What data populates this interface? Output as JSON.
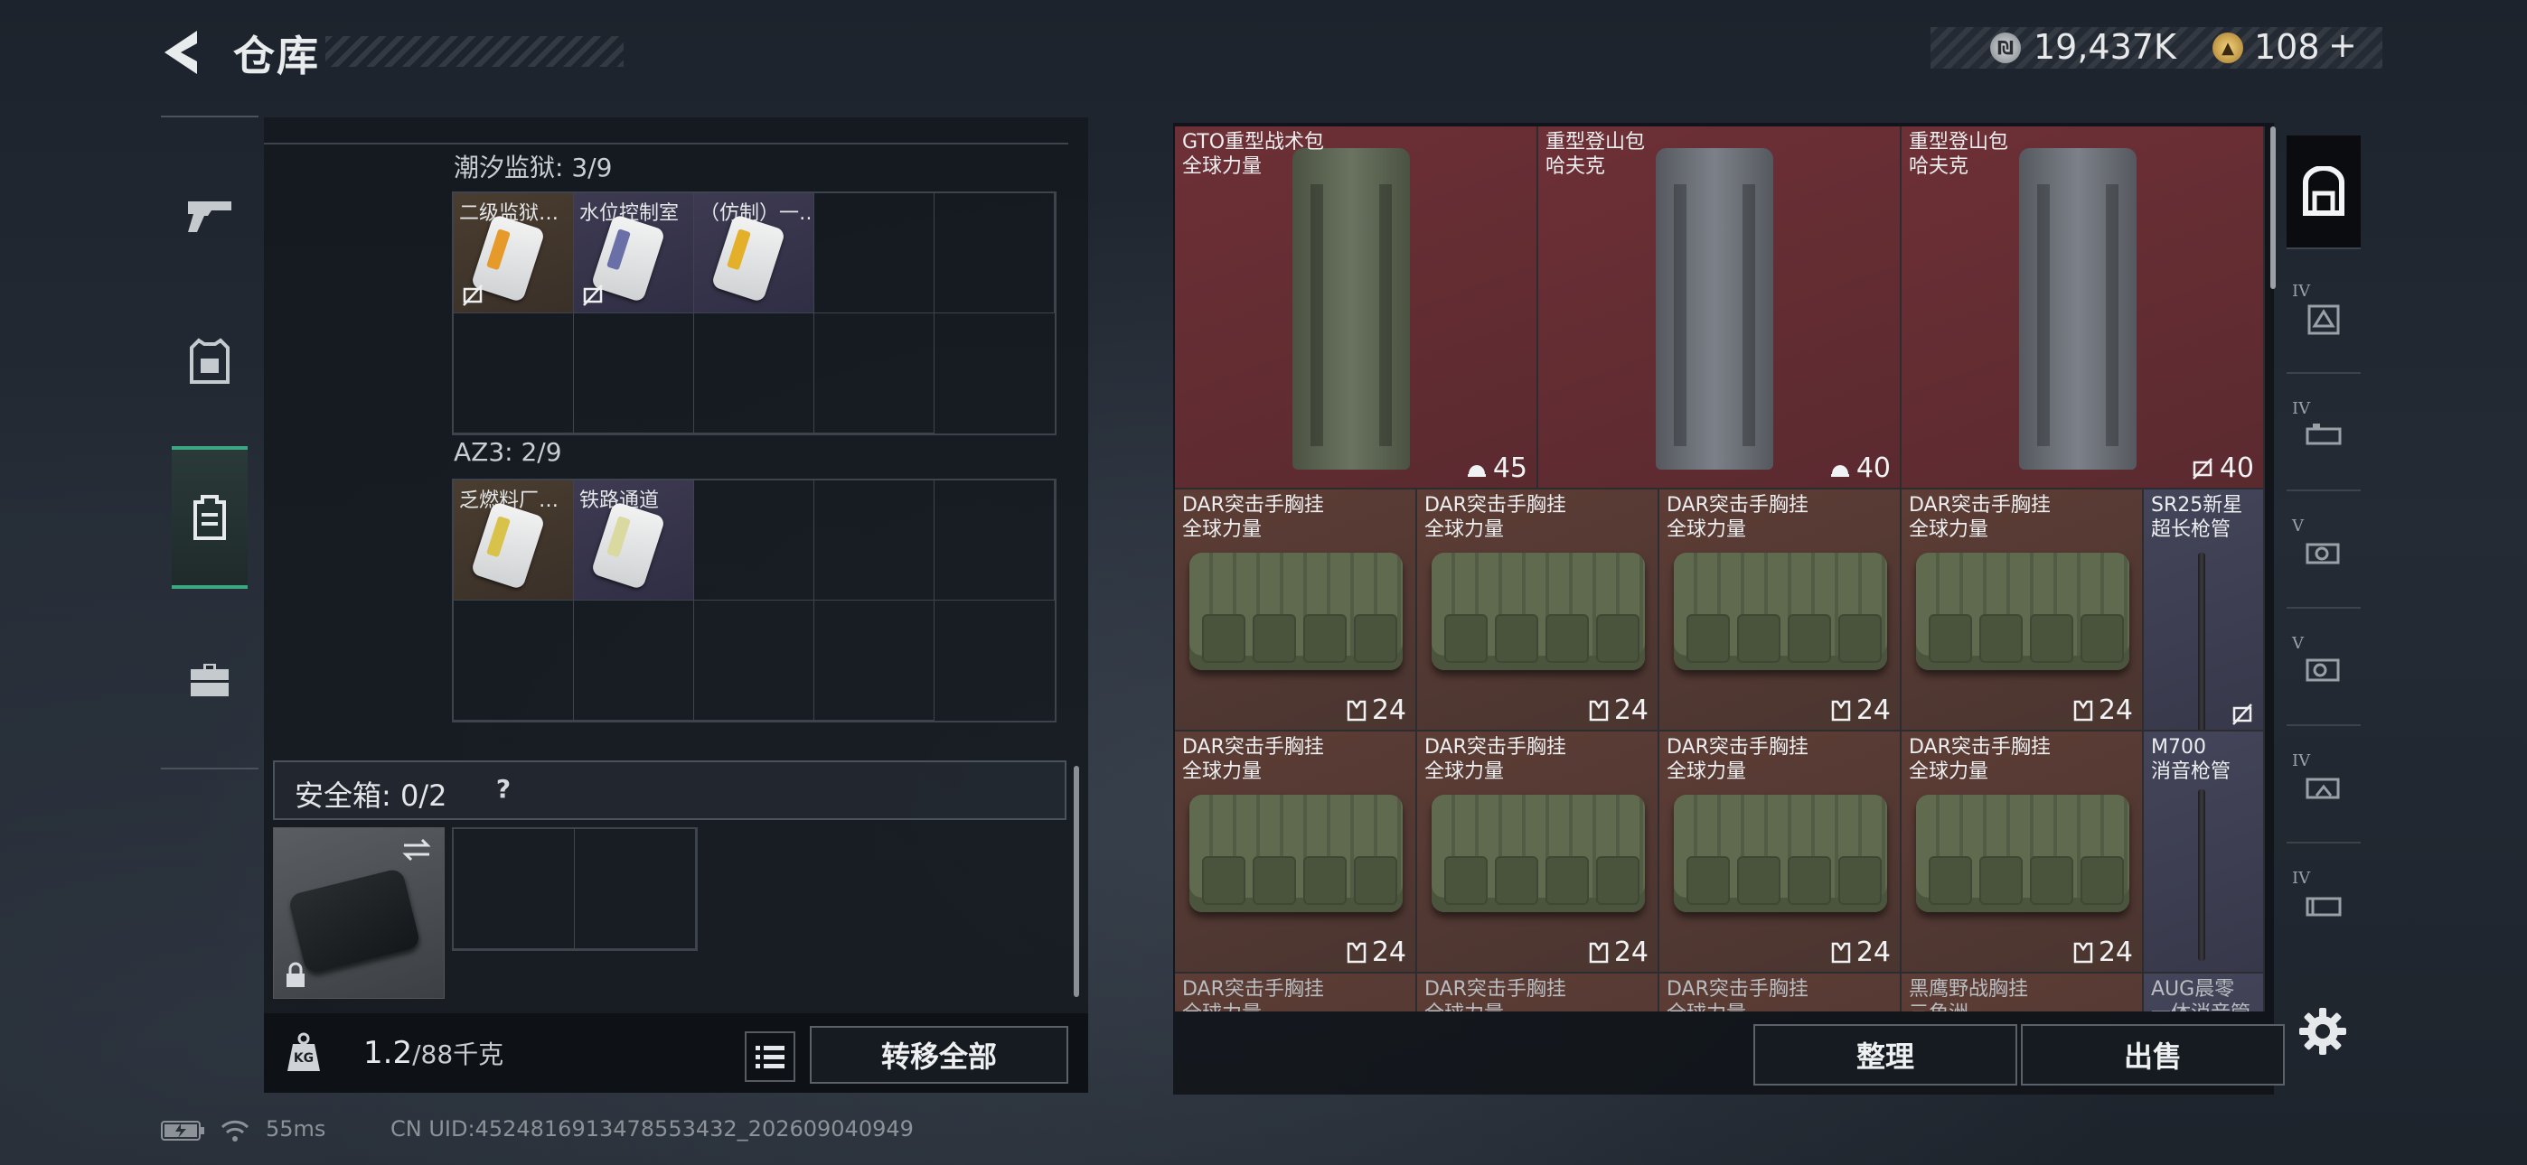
{
  "header": {
    "title": "仓库"
  },
  "currency": {
    "silver": "19,437K",
    "gold": "108",
    "plus": "+"
  },
  "left_nav": [
    {
      "icon": "pistol-icon"
    },
    {
      "icon": "armor-icon"
    },
    {
      "icon": "backpack-icon"
    },
    {
      "icon": "toolbox-icon"
    }
  ],
  "keycards": {
    "chaoxi": {
      "label": "潮汐监狱: 3/9",
      "cards": [
        {
          "name": "二级监狱…",
          "stripe": "#e59a2a"
        },
        {
          "name": "水位控制室（仿制）…",
          "stripe": "#6a6fa8"
        },
        {
          "name": "（仿制）一…",
          "stripe": "#e4b02a"
        }
      ]
    },
    "az3": {
      "label": "AZ3: 2/9",
      "cards": [
        {
          "name": "乏燃料厂…",
          "stripe": "#d8c24a"
        },
        {
          "name": "铁路通道",
          "stripe": "#d9d9a0"
        }
      ]
    }
  },
  "safebox": {
    "label": "安全箱: 0/2",
    "help": "?"
  },
  "weight": {
    "current": "1.2",
    "capacity": "/88千克",
    "icon_text": "KG"
  },
  "buttons": {
    "transfer_all": "转移全部",
    "sort": "整理",
    "sell": "出售"
  },
  "stash": {
    "backpacks": [
      {
        "name1": "GTO重型战术包",
        "name2": "全球力量",
        "count": "45",
        "count_icon": "helmet-icon",
        "color": "#5c6453"
      },
      {
        "name1": "重型登山包",
        "name2": "哈夫克",
        "count": "40",
        "count_icon": "helmet-icon",
        "color": "#6a6f7a"
      },
      {
        "name1": "重型登山包",
        "name2": "哈夫克",
        "count": "40",
        "count_icon": "no-insure-icon",
        "color": "#6a6f7a"
      }
    ],
    "rigs_row1": [
      {
        "name1": "DAR突击手胸挂",
        "name2": "全球力量",
        "count": "24"
      },
      {
        "name1": "DAR突击手胸挂",
        "name2": "全球力量",
        "count": "24"
      },
      {
        "name1": "DAR突击手胸挂",
        "name2": "全球力量",
        "count": "24"
      },
      {
        "name1": "DAR突击手胸挂",
        "name2": "全球力量",
        "count": "24"
      }
    ],
    "rigs_row2": [
      {
        "name1": "DAR突击手胸挂",
        "name2": "全球力量",
        "count": "24"
      },
      {
        "name1": "DAR突击手胸挂",
        "name2": "全球力量",
        "count": "24"
      },
      {
        "name1": "DAR突击手胸挂",
        "name2": "全球力量",
        "count": "24"
      },
      {
        "name1": "DAR突击手胸挂",
        "name2": "全球力量",
        "count": "24"
      }
    ],
    "rigs_row3": [
      {
        "name1": "DAR突击手胸挂",
        "name2": "全球力量"
      },
      {
        "name1": "DAR突击手胸挂",
        "name2": "全球力量"
      },
      {
        "name1": "DAR突击手胸挂",
        "name2": "全球力量"
      },
      {
        "name1": "黑鹰野战胸挂",
        "name2": "三角洲"
      }
    ],
    "side_items": [
      {
        "name1": "SR25新星",
        "name2": "超长枪管"
      },
      {
        "name1": "M700",
        "name2": "消音枪管"
      },
      {
        "name1": "AUG晨零",
        "name2": "一体消音管"
      }
    ]
  },
  "right_nav": [
    {
      "tier": "",
      "icon": "backpack-category-icon"
    },
    {
      "tier": "IV",
      "icon": "armor-category-icon"
    },
    {
      "tier": "IV",
      "icon": "scope-category-icon"
    },
    {
      "tier": "V",
      "icon": "weapon-part-icon"
    },
    {
      "tier": "V",
      "icon": "grip-category-icon"
    },
    {
      "tier": "IV",
      "icon": "stock-category-icon"
    },
    {
      "tier": "IV",
      "icon": "magazine-category-icon"
    }
  ],
  "status": {
    "ping": "55ms",
    "uid": "CN UID:4524816913478553432_202609040949"
  }
}
